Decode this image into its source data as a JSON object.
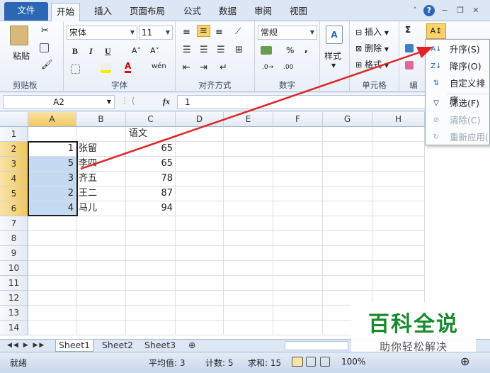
{
  "tabs": [
    "文件",
    "开始",
    "插入",
    "页面布局",
    "公式",
    "数据",
    "审阅",
    "视图"
  ],
  "ribbon": {
    "paste": "粘贴",
    "clipboard": "剪贴板",
    "font_name": "宋体",
    "font_size": "11",
    "font_group": "字体",
    "bold": "B",
    "italic": "I",
    "underline": "U",
    "grow": "A˄",
    "shrink": "A˅",
    "wen": "wén",
    "align_group": "对齐方式",
    "number_format": "常规",
    "pct": "%",
    "comma": ",",
    "number_group": "数字",
    "style": "样式",
    "insert": "插入",
    "delete": "删除",
    "format": "格式",
    "cells_group": "单元格",
    "sigma": "Σ",
    "edit_group": "编"
  },
  "formula": {
    "namebox": "A2",
    "fx": "fx",
    "value": "1"
  },
  "columns": [
    "A",
    "B",
    "C",
    "D",
    "E",
    "F",
    "G",
    "H"
  ],
  "rows": [
    "1",
    "2",
    "3",
    "4",
    "5",
    "6",
    "7",
    "8",
    "9",
    "10",
    "11",
    "12",
    "13",
    "14"
  ],
  "cells": {
    "c1": "语文",
    "a2": "1",
    "b2": "张留",
    "c2": "65",
    "a3": "5",
    "b3": "李四",
    "c3": "65",
    "a4": "3",
    "b4": "齐五",
    "c4": "78",
    "a5": "2",
    "b5": "王二",
    "c5": "87",
    "a6": "4",
    "b6": "马儿",
    "c6": "94"
  },
  "sort_menu": {
    "asc": "升序(S)",
    "desc": "降序(O)",
    "custom": "自定义排序",
    "filter": "筛选(F)",
    "clear": "清除(C)",
    "reapply": "重新应用("
  },
  "sheets": [
    "Sheet1",
    "Sheet2",
    "Sheet3"
  ],
  "status": {
    "mode": "就绪",
    "avg": "平均值: 3",
    "count": "计数: 5",
    "sum": "求和: 15",
    "zoom": "100%"
  },
  "watermark": {
    "title": "百科全说",
    "subtitle": "助你轻松解决"
  },
  "colors": {
    "accent": "#2b67b4",
    "selection": "#c5daf1",
    "highlight": "#f9d98b",
    "arrow": "#e02424",
    "watermark": "#1a8a2e"
  }
}
